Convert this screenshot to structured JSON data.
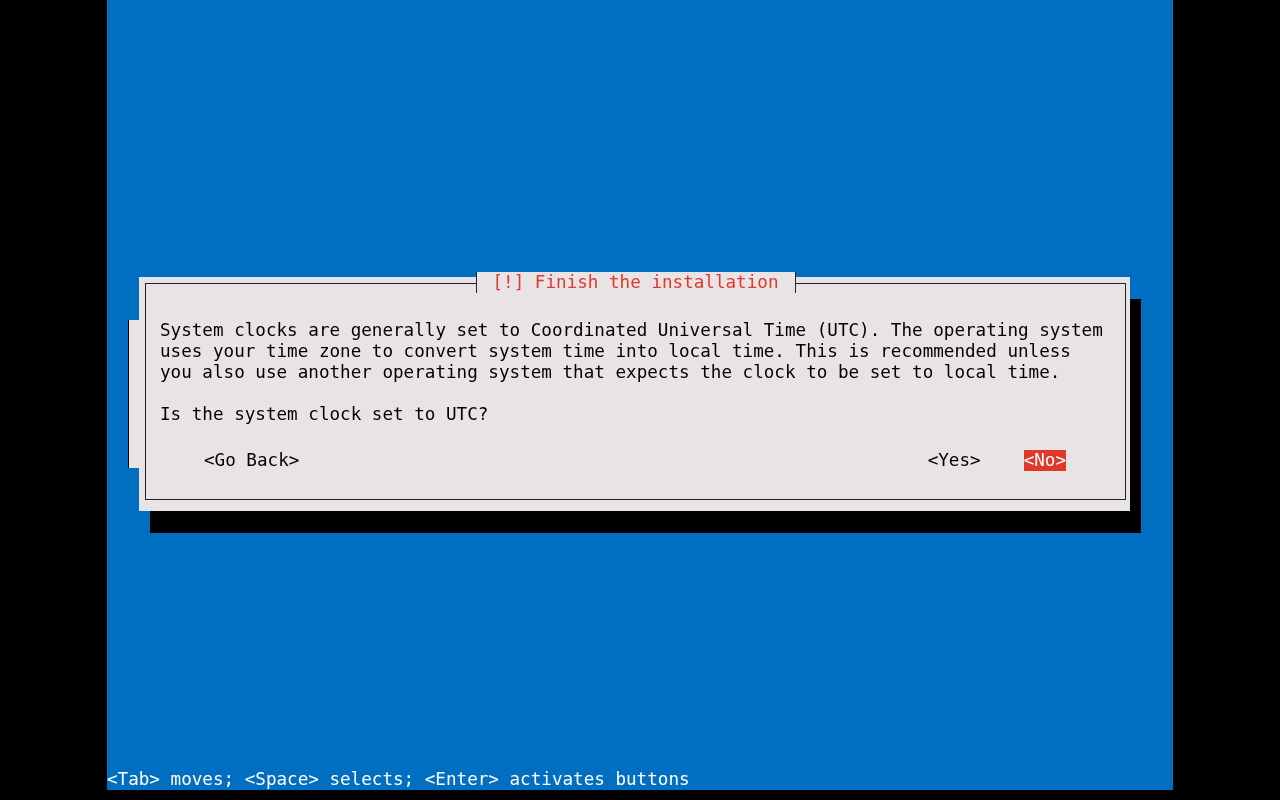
{
  "dialog": {
    "title": "[!] Finish the installation",
    "message": "System clocks are generally set to Coordinated Universal Time (UTC). The operating system uses your time zone to convert system time into local time. This is recommended unless you also use another operating system that expects the clock to be set to local time.",
    "question": "Is the system clock set to UTC?",
    "buttons": [
      {
        "label": "<Go Back>",
        "selected": false
      },
      {
        "label": "<Yes>",
        "selected": false
      },
      {
        "label": "<No>",
        "selected": true
      }
    ]
  },
  "status_bar": "<Tab> moves; <Space> selects; <Enter> activates buttons"
}
